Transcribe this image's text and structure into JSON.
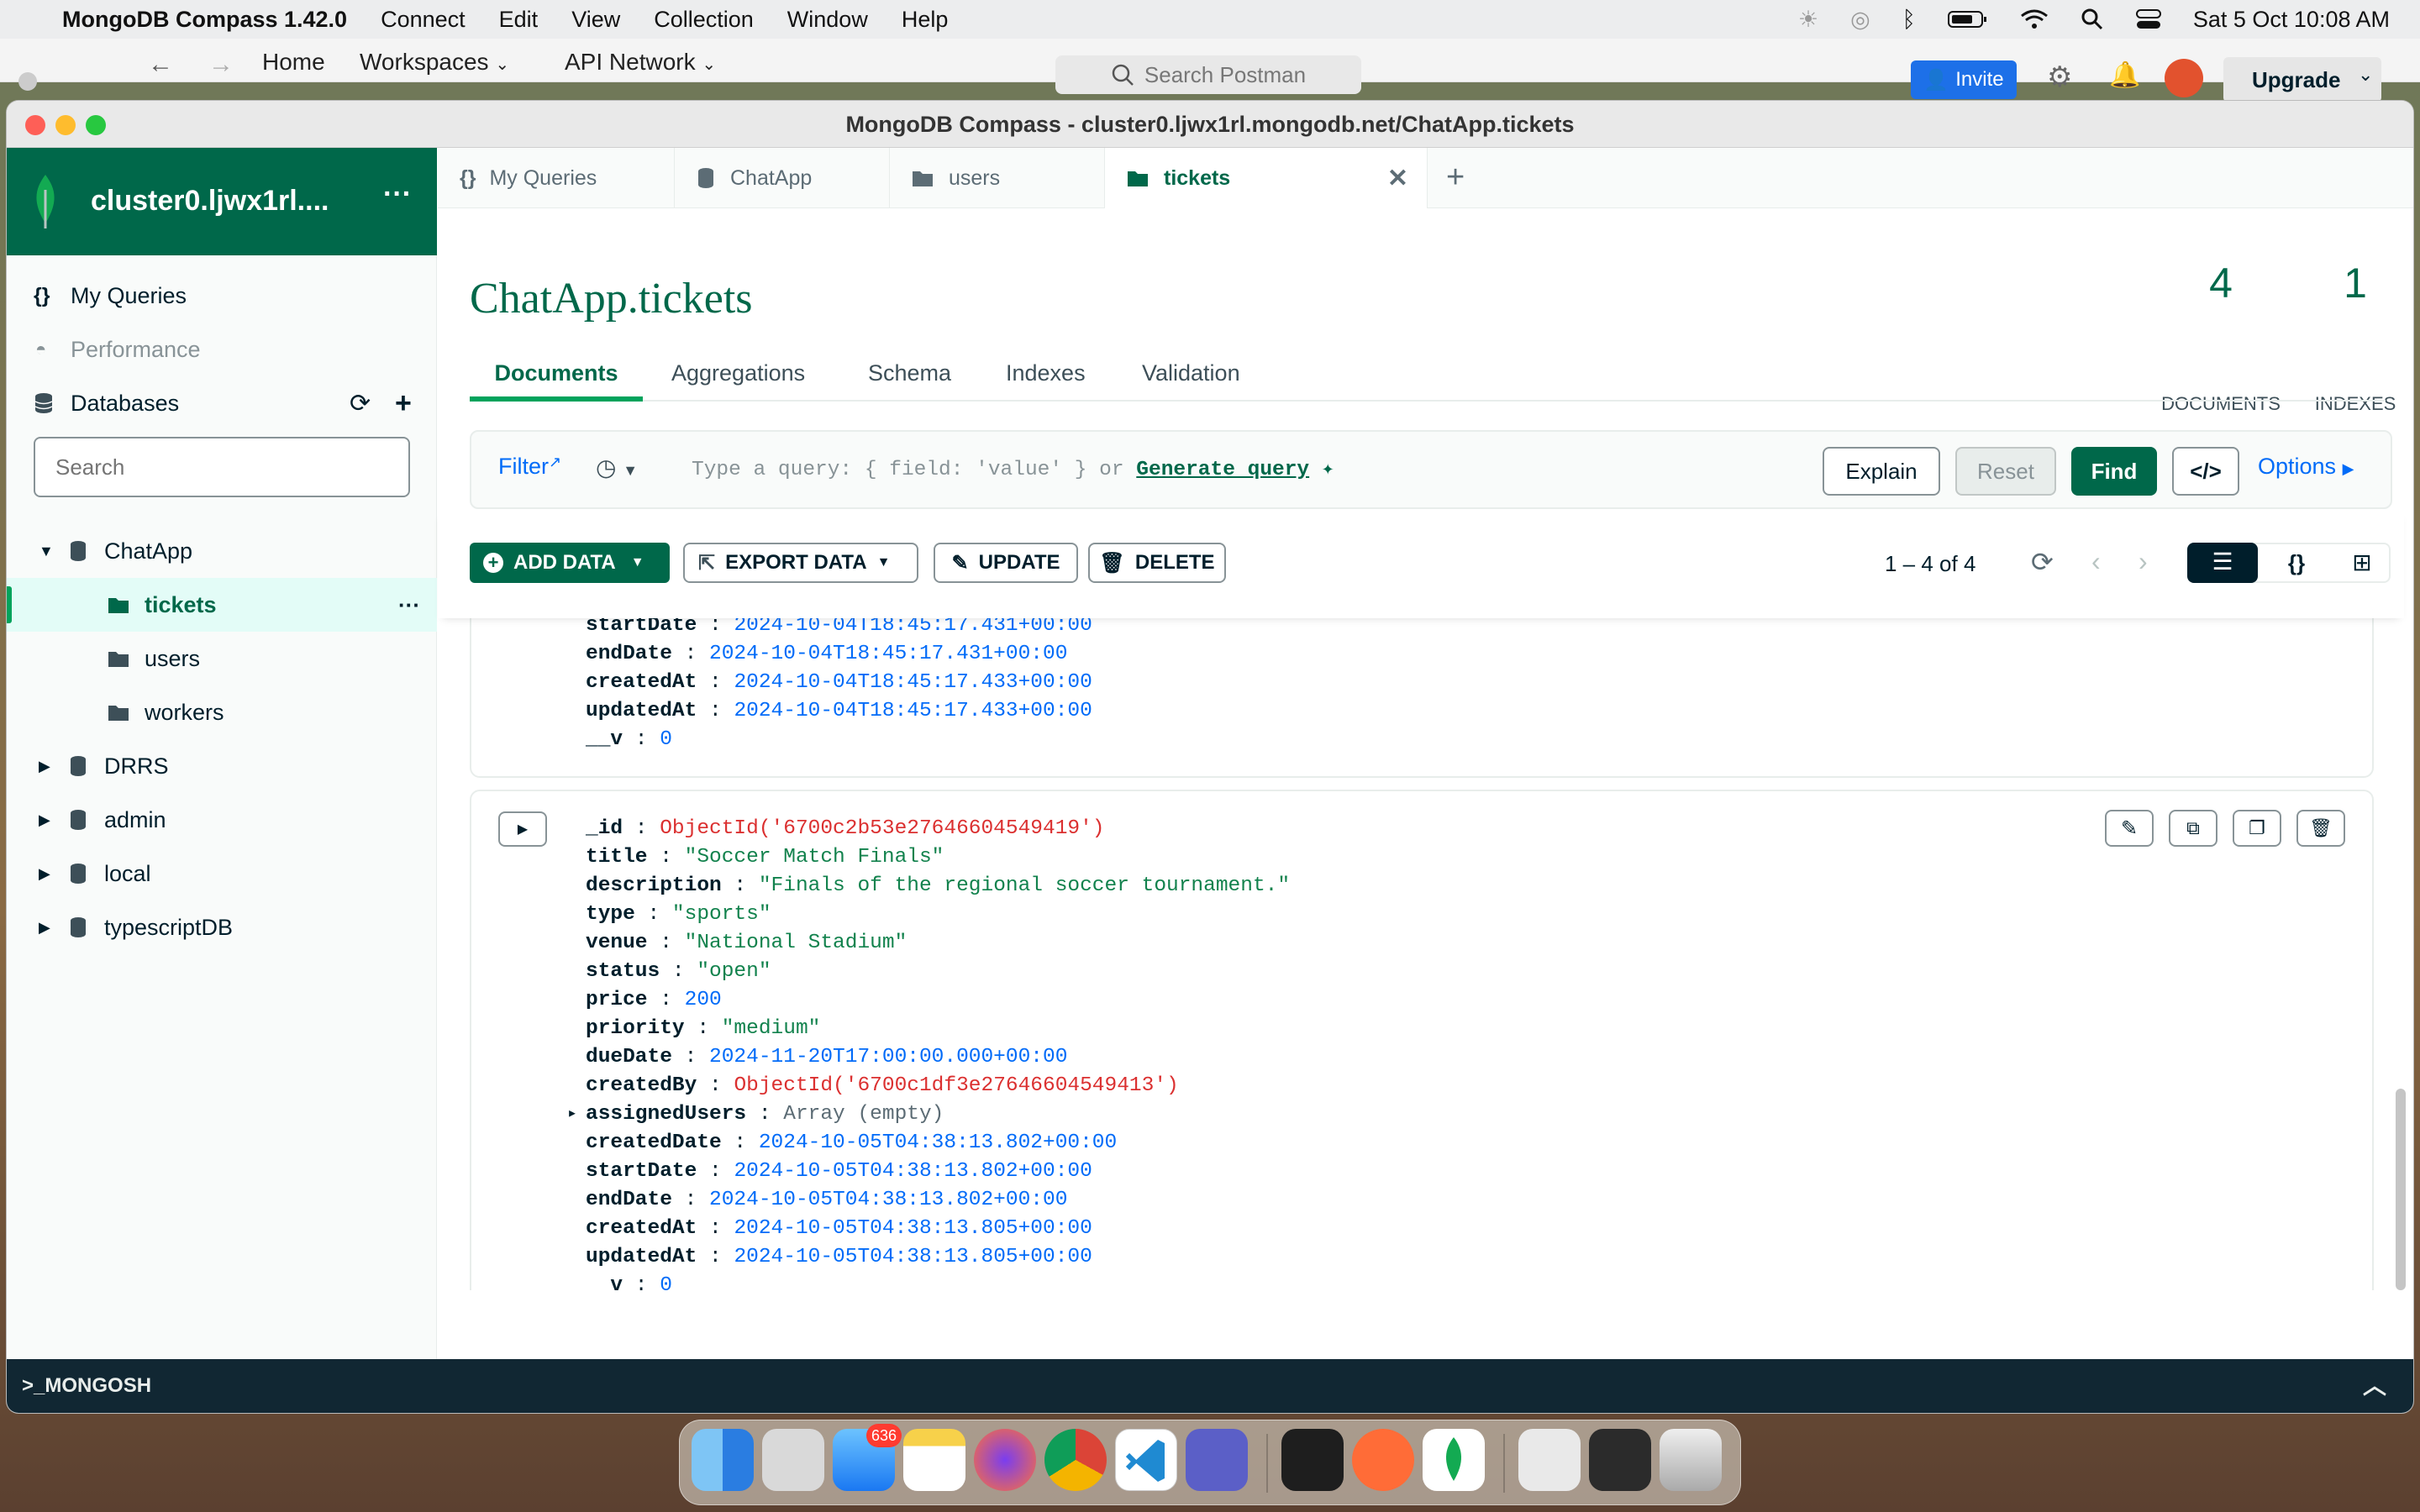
{
  "menubar": {
    "app_name": "MongoDB Compass 1.42.0",
    "menus": [
      "Connect",
      "Edit",
      "View",
      "Collection",
      "Window",
      "Help"
    ],
    "datetime": "Sat 5 Oct  10:08 AM"
  },
  "postman": {
    "home": "Home",
    "workspaces": "Workspaces",
    "api_network": "API Network",
    "search_placeholder": "Search Postman",
    "invite": "Invite",
    "upgrade": "Upgrade"
  },
  "window": {
    "title": "MongoDB Compass - cluster0.ljwx1rl.mongodb.net/ChatApp.tickets"
  },
  "sidebar": {
    "cluster_name": "cluster0.ljwx1rl....",
    "my_queries": "My Queries",
    "performance": "Performance",
    "databases": "Databases",
    "search_placeholder": "Search",
    "tree": [
      {
        "label": "ChatApp",
        "expanded": true
      },
      {
        "label": "tickets",
        "selected": true
      },
      {
        "label": "users"
      },
      {
        "label": "workers"
      },
      {
        "label": "DRRS"
      },
      {
        "label": "admin"
      },
      {
        "label": "local"
      },
      {
        "label": "typescriptDB"
      }
    ]
  },
  "tabs": [
    {
      "label": "My Queries",
      "icon": "braces-icon"
    },
    {
      "label": "ChatApp",
      "icon": "database-icon"
    },
    {
      "label": "users",
      "icon": "folder-icon"
    },
    {
      "label": "tickets",
      "icon": "folder-icon",
      "active": true
    }
  ],
  "collection": {
    "title": "ChatApp.tickets",
    "documents_count": "4",
    "documents_label": "DOCUMENTS",
    "indexes_count": "1",
    "indexes_label": "INDEXES"
  },
  "subtabs": [
    "Documents",
    "Aggregations",
    "Schema",
    "Indexes",
    "Validation"
  ],
  "query": {
    "filter_label": "Filter",
    "placeholder": "Type a query: { field: 'value' } or",
    "generate": "Generate query",
    "explain": "Explain",
    "reset": "Reset",
    "find": "Find",
    "options": "Options"
  },
  "toolbar": {
    "add_data": "ADD DATA",
    "export_data": "EXPORT DATA",
    "update": "UPDATE",
    "delete": "DELETE",
    "pagination": "1 – 4 of 4"
  },
  "doc_partial": [
    {
      "key": "startDate",
      "value": "2024-10-04T18:45:17.431+00:00",
      "kind": "n"
    },
    {
      "key": "endDate",
      "value": "2024-10-04T18:45:17.431+00:00",
      "kind": "n"
    },
    {
      "key": "createdAt",
      "value": "2024-10-04T18:45:17.433+00:00",
      "kind": "n"
    },
    {
      "key": "updatedAt",
      "value": "2024-10-04T18:45:17.433+00:00",
      "kind": "n"
    },
    {
      "key": "__v",
      "value": "0",
      "kind": "n"
    }
  ],
  "doc_full": [
    {
      "key": "_id",
      "value": "ObjectId('6700c2b53e27646604549419')",
      "kind": "o"
    },
    {
      "key": "title",
      "value": "\"Soccer Match Finals\"",
      "kind": "s"
    },
    {
      "key": "description",
      "value": "\"Finals of the regional soccer tournament.\"",
      "kind": "s"
    },
    {
      "key": "type",
      "value": "\"sports\"",
      "kind": "s"
    },
    {
      "key": "venue",
      "value": "\"National Stadium\"",
      "kind": "s"
    },
    {
      "key": "status",
      "value": "\"open\"",
      "kind": "s"
    },
    {
      "key": "price",
      "value": "200",
      "kind": "n"
    },
    {
      "key": "priority",
      "value": "\"medium\"",
      "kind": "s"
    },
    {
      "key": "dueDate",
      "value": "2024-11-20T17:00:00.000+00:00",
      "kind": "n"
    },
    {
      "key": "createdBy",
      "value": "ObjectId('6700c1df3e27646604549413')",
      "kind": "o"
    },
    {
      "key": "assignedUsers",
      "value": "Array (empty)",
      "kind": "g"
    },
    {
      "key": "createdDate",
      "value": "2024-10-05T04:38:13.802+00:00",
      "kind": "n"
    },
    {
      "key": "startDate",
      "value": "2024-10-05T04:38:13.802+00:00",
      "kind": "n"
    },
    {
      "key": "endDate",
      "value": "2024-10-05T04:38:13.802+00:00",
      "kind": "n"
    },
    {
      "key": "createdAt",
      "value": "2024-10-05T04:38:13.805+00:00",
      "kind": "n"
    },
    {
      "key": "updatedAt",
      "value": "2024-10-05T04:38:13.805+00:00",
      "kind": "n"
    },
    {
      "key": "__v",
      "value": "0",
      "kind": "n"
    }
  ],
  "mongosh": ">_MONGOSH",
  "dock": {
    "mail_badge": "636",
    "apps": [
      "finder",
      "launchpad",
      "mail",
      "notes",
      "firefox",
      "chrome",
      "vscode",
      "teams",
      "figma",
      "postman",
      "mongodb-compass",
      "preview",
      "terminal",
      "trash"
    ]
  },
  "colors": {
    "brand_green": "#00684a",
    "find_green": "#00684a",
    "string": "#12824d",
    "number": "#016bf8",
    "objectid": "#db3030"
  }
}
